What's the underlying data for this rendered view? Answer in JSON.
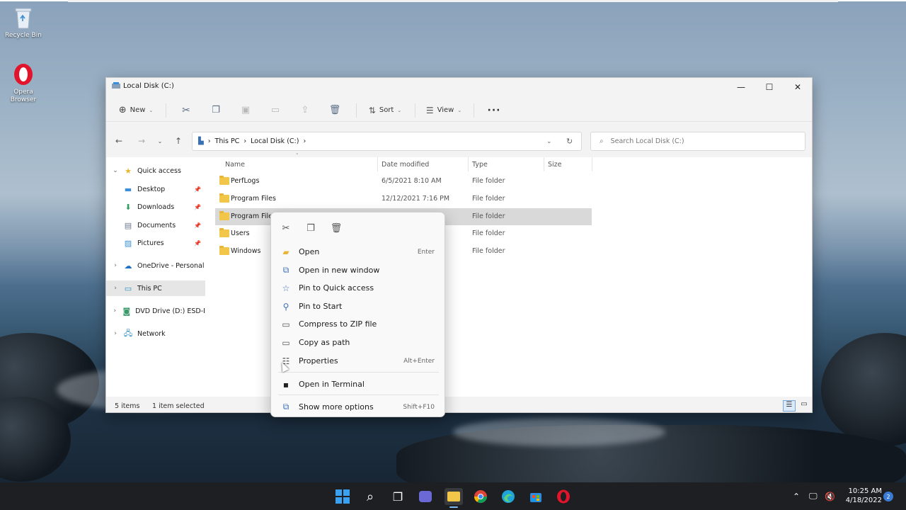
{
  "desktop": {
    "icons": [
      {
        "label": "Recycle Bin"
      },
      {
        "label": "Opera\nBrowser"
      }
    ]
  },
  "window": {
    "title": "Local Disk (C:)",
    "controls": {
      "minimize": "—",
      "maximize": "☐",
      "close": "✕"
    },
    "toolbar": {
      "new_label": "New",
      "sort_label": "Sort",
      "view_label": "View",
      "more_label": "···"
    },
    "address": {
      "segments": [
        "This PC",
        "Local Disk (C:)"
      ],
      "separator": "›"
    },
    "search": {
      "placeholder": "Search Local Disk (C:)"
    },
    "sidebar": {
      "items": [
        {
          "label": "Quick access",
          "icon": "star-icon"
        },
        {
          "label": "Desktop",
          "icon": "desktop-icon"
        },
        {
          "label": "Downloads",
          "icon": "download-icon"
        },
        {
          "label": "Documents",
          "icon": "document-icon"
        },
        {
          "label": "Pictures",
          "icon": "pictures-icon"
        },
        {
          "label": "OneDrive - Personal",
          "icon": "cloud-icon"
        },
        {
          "label": "This PC",
          "icon": "computer-icon"
        },
        {
          "label": "DVD Drive (D:) ESD-I",
          "icon": "dvd-icon"
        },
        {
          "label": "Network",
          "icon": "network-icon"
        }
      ]
    },
    "columns": {
      "name": "Name",
      "date": "Date modified",
      "type": "Type",
      "size": "Size"
    },
    "files": [
      {
        "name": "PerfLogs",
        "date": "6/5/2021 8:10 AM",
        "type": "File folder"
      },
      {
        "name": "Program Files",
        "date": "12/12/2021 7:16 PM",
        "type": "File folder"
      },
      {
        "name": "Program File",
        "date": "",
        "type": "File folder"
      },
      {
        "name": "Users",
        "date": "",
        "type": "File folder"
      },
      {
        "name": "Windows",
        "date": "",
        "type": "File folder"
      }
    ],
    "status": {
      "count": "5 items",
      "selected": "1 item selected"
    }
  },
  "context_menu": {
    "items": [
      {
        "label": "Open",
        "shortcut": "Enter",
        "icon": "folder-open-icon"
      },
      {
        "label": "Open in new window",
        "shortcut": "",
        "icon": "new-window-icon"
      },
      {
        "label": "Pin to Quick access",
        "shortcut": "",
        "icon": "star-icon"
      },
      {
        "label": "Pin to Start",
        "shortcut": "",
        "icon": "pin-icon"
      },
      {
        "label": "Compress to ZIP file",
        "shortcut": "",
        "icon": "zip-icon"
      },
      {
        "label": "Copy as path",
        "shortcut": "",
        "icon": "path-icon"
      },
      {
        "label": "Properties",
        "shortcut": "Alt+Enter",
        "icon": "properties-icon"
      },
      {
        "label": "Open in Terminal",
        "shortcut": "",
        "icon": "terminal-icon"
      },
      {
        "label": "Show more options",
        "shortcut": "Shift+F10",
        "icon": "more-options-icon"
      }
    ]
  },
  "taskbar": {
    "time": "10:25 AM",
    "date": "4/18/2022",
    "notifications": "2"
  }
}
